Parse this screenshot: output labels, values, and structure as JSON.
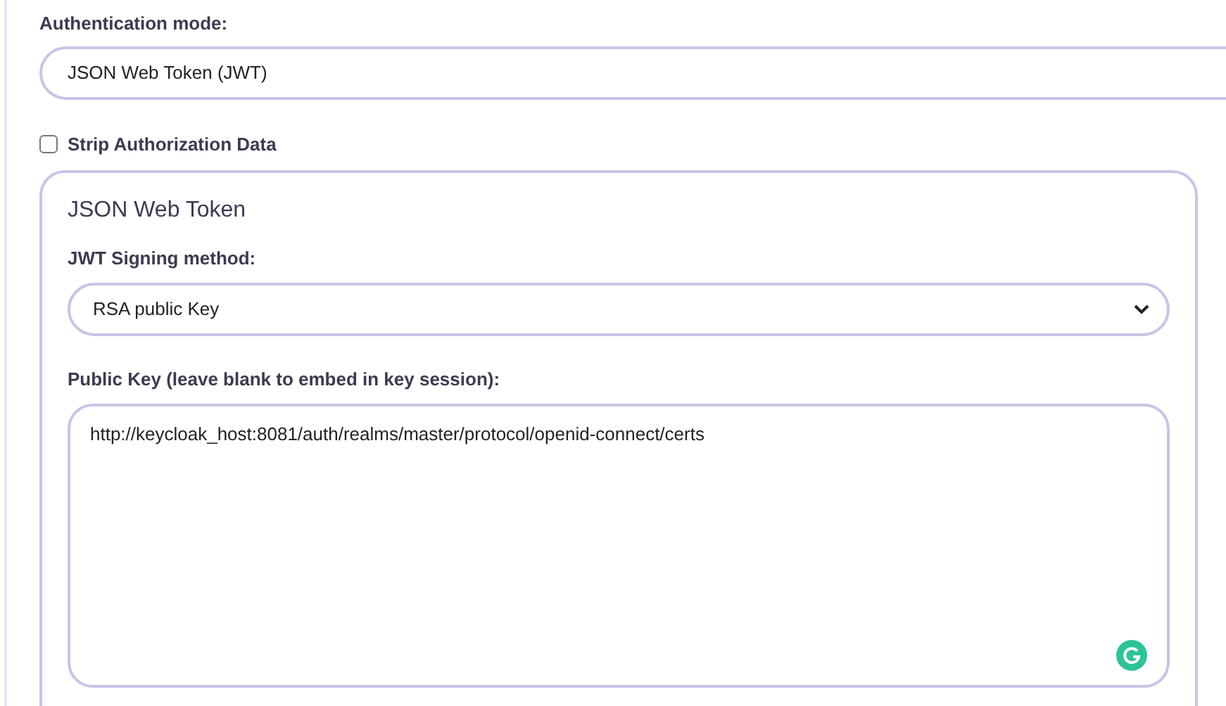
{
  "auth_mode": {
    "label": "Authentication mode:",
    "value": "JSON Web Token (JWT)"
  },
  "strip_authorization": {
    "label": "Strip Authorization Data",
    "checked": false
  },
  "jwt_panel": {
    "title": "JSON Web Token",
    "signing_method": {
      "label": "JWT Signing method:",
      "value": "RSA public Key"
    },
    "public_key": {
      "label": "Public Key (leave blank to embed in key session):",
      "value": "http://keycloak_host:8081/auth/realms/master/protocol/openid-connect/certs"
    }
  }
}
